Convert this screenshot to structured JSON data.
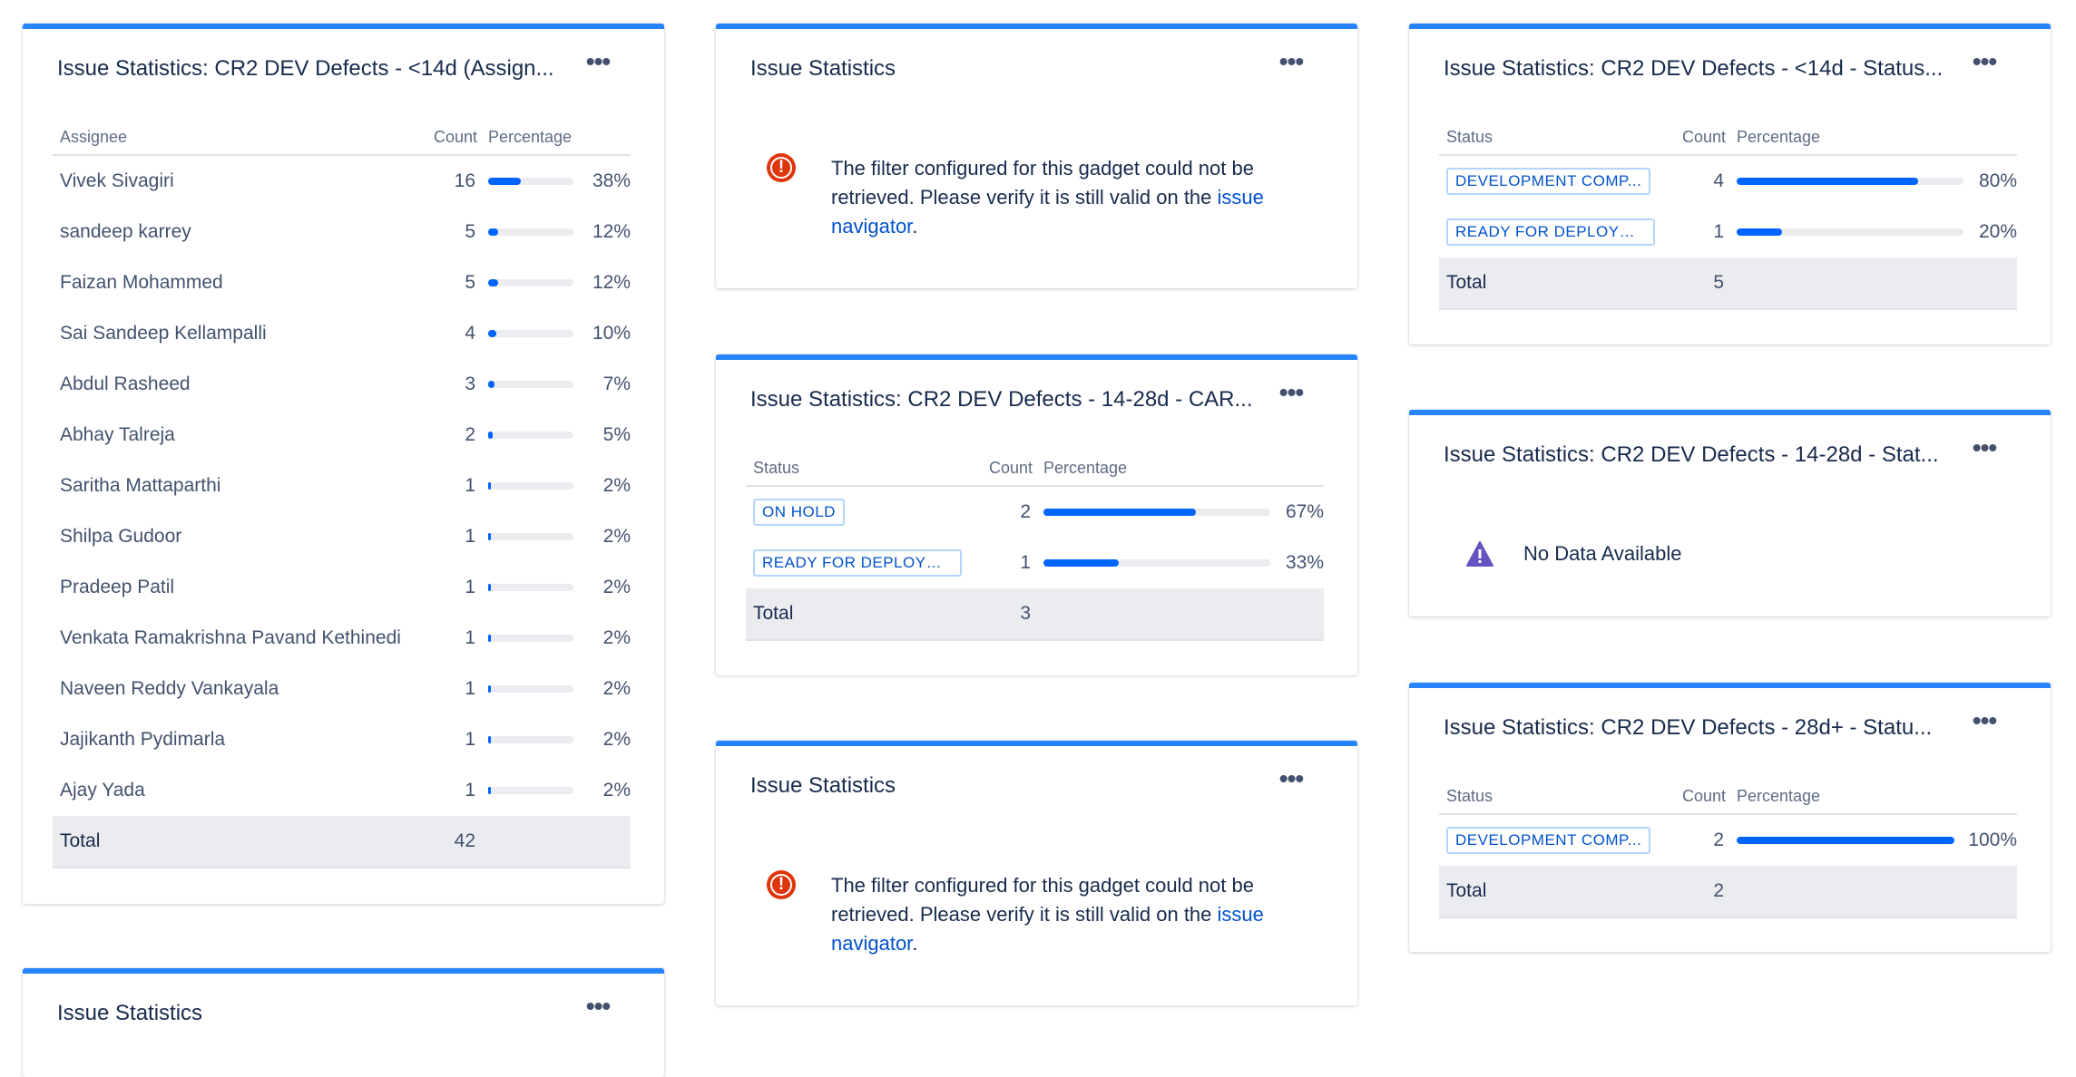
{
  "gadgets": {
    "assignee": {
      "title": "Issue Statistics: CR2 DEV Defects - <14d (Assign...",
      "headers": {
        "name": "Assignee",
        "count": "Count",
        "pct": "Percentage"
      },
      "rows": [
        {
          "name": "Vivek Sivagiri",
          "count": "16",
          "pct": "38%",
          "fill": 0.38
        },
        {
          "name": "sandeep karrey",
          "count": "5",
          "pct": "12%",
          "fill": 0.12
        },
        {
          "name": "Faizan Mohammed",
          "count": "5",
          "pct": "12%",
          "fill": 0.12
        },
        {
          "name": "Sai Sandeep Kellampalli",
          "count": "4",
          "pct": "10%",
          "fill": 0.1
        },
        {
          "name": "Abdul Rasheed",
          "count": "3",
          "pct": "7%",
          "fill": 0.07
        },
        {
          "name": "Abhay Talreja",
          "count": "2",
          "pct": "5%",
          "fill": 0.05
        },
        {
          "name": "Saritha Mattaparthi",
          "count": "1",
          "pct": "2%",
          "fill": 0.02
        },
        {
          "name": "Shilpa Gudoor",
          "count": "1",
          "pct": "2%",
          "fill": 0.02
        },
        {
          "name": "Pradeep Patil",
          "count": "1",
          "pct": "2%",
          "fill": 0.02
        },
        {
          "name": "Venkata Ramakrishna Pavand Kethinedi",
          "count": "1",
          "pct": "2%",
          "fill": 0.02
        },
        {
          "name": "Naveen Reddy Vankayala",
          "count": "1",
          "pct": "2%",
          "fill": 0.02
        },
        {
          "name": "Jajikanth Pydimarla",
          "count": "1",
          "pct": "2%",
          "fill": 0.02
        },
        {
          "name": "Ajay Yada",
          "count": "1",
          "pct": "2%",
          "fill": 0.02
        }
      ],
      "total_label": "Total",
      "total_count": "42"
    },
    "bottom_left": {
      "title": "Issue Statistics"
    },
    "error_top": {
      "title": "Issue Statistics",
      "message": "The filter configured for this gadget could not be retrieved. Please verify it is still valid on the",
      "link": "issue navigator",
      "suffix": "."
    },
    "car": {
      "title": "Issue Statistics: CR2 DEV Defects - 14-28d - CAR...",
      "headers": {
        "name": "Status",
        "count": "Count",
        "pct": "Percentage"
      },
      "rows": [
        {
          "name": "ON HOLD",
          "count": "2",
          "pct": "67%",
          "fill": 0.67
        },
        {
          "name": "READY FOR DEPLOYM...",
          "count": "1",
          "pct": "33%",
          "fill": 0.33
        }
      ],
      "total_label": "Total",
      "total_count": "3"
    },
    "error_bottom": {
      "title": "Issue Statistics",
      "message": "The filter configured for this gadget could not be retrieved. Please verify it is still valid on the",
      "link": "issue navigator",
      "suffix": "."
    },
    "status14": {
      "title": "Issue Statistics: CR2 DEV Defects - <14d - Status...",
      "headers": {
        "name": "Status",
        "count": "Count",
        "pct": "Percentage"
      },
      "rows": [
        {
          "name": "DEVELOPMENT COMP...",
          "count": "4",
          "pct": "80%",
          "fill": 0.8
        },
        {
          "name": "READY FOR DEPLOYM...",
          "count": "1",
          "pct": "20%",
          "fill": 0.2
        }
      ],
      "total_label": "Total",
      "total_count": "5"
    },
    "stat1428": {
      "title": "Issue Statistics: CR2 DEV Defects - 14-28d - Stat...",
      "message": "No Data Available"
    },
    "status28": {
      "title": "Issue Statistics: CR2 DEV Defects - 28d+ - Statu...",
      "headers": {
        "name": "Status",
        "count": "Count",
        "pct": "Percentage"
      },
      "rows": [
        {
          "name": "DEVELOPMENT COMP...",
          "count": "2",
          "pct": "100%",
          "fill": 1.0
        }
      ],
      "total_label": "Total",
      "total_count": "2"
    }
  },
  "menu_glyph": "•••",
  "colors": {
    "accent": "#2684ff",
    "bar": "#0065ff",
    "error": "#de350b",
    "warning": "#6554c0",
    "link": "#0052cc"
  }
}
